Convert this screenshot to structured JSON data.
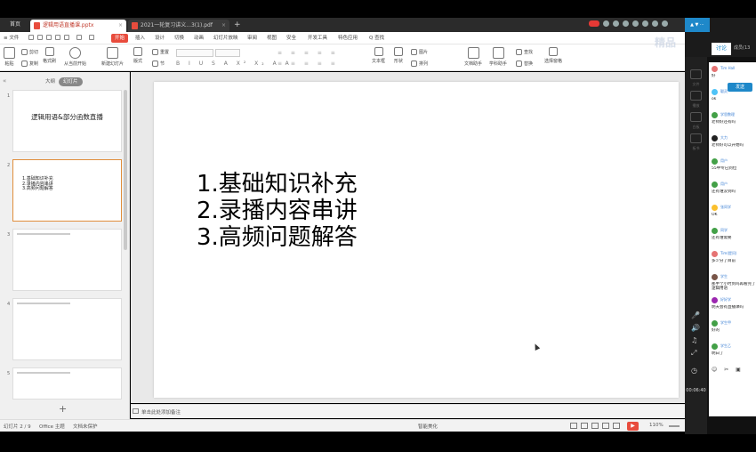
{
  "tabs": {
    "home": "首页",
    "active_doc": "逻辑用语直播课.pptx",
    "other_doc": "2021一轮复习讲义...3(1).pdf",
    "active_color": "#e84c3d",
    "pdf_color": "#e84c3d"
  },
  "menu": {
    "file": "≡ 文件",
    "start": "开始",
    "items": [
      "插入",
      "设计",
      "切换",
      "动画",
      "幻灯片放映",
      "审阅",
      "视图",
      "安全",
      "开发工具",
      "特色应用",
      "Q 查找"
    ]
  },
  "toolbar": {
    "paste": "粘贴",
    "cut": "剪切",
    "copy": "复制",
    "format_painter": "格式刷",
    "from_current": "从当前开始",
    "new_slide": "新建幻灯片",
    "layout": "版式",
    "section": "节",
    "reset": "重置",
    "textbox": "文本框",
    "shape": "形状",
    "arrange": "排列",
    "picture": "图片",
    "doc_assistant": "文档助手",
    "math_assistant": "学科助手",
    "find": "查找",
    "replace": "替换",
    "select_pane": "选择窗格",
    "format_glyphs": "B I U S A X² X₂ A A",
    "align_glyphs": "≡ ≡ ≡ ≡ ≡"
  },
  "panel": {
    "outline_tab": "大纲",
    "slides_tab": "幻灯片",
    "add_glyph": "+",
    "slides": [
      {
        "num": "1",
        "title": "逻辑用语&部分函数直播",
        "lines": []
      },
      {
        "num": "2",
        "title": "",
        "lines": [
          "1.基础知识补充",
          "2.录播内容串讲",
          "3.高频问题解答"
        ]
      },
      {
        "num": "3",
        "title": "",
        "lines": []
      },
      {
        "num": "4",
        "title": "",
        "lines": []
      },
      {
        "num": "5",
        "title": "",
        "lines": []
      }
    ]
  },
  "slide": {
    "lines": [
      "1.基础知识补充",
      "2.录播内容串讲",
      "3.高频问题解答"
    ]
  },
  "notes": {
    "placeholder": "单击此处添加备注"
  },
  "status": {
    "slide_counter": "幻灯片 2 / 9",
    "theme": "Office 主题",
    "doc_protection": "文档未保护",
    "smart_beautify": "智能美化",
    "zoom": "110%"
  },
  "live": {
    "tab_discuss": "讨论",
    "tab_members": "成员(13",
    "watermark": "精品",
    "timer": "00:06:40",
    "side_labels": [
      "文件",
      "播放",
      "白板",
      "板书"
    ],
    "send": "发送",
    "messages": [
      {
        "name": "Tim Hall",
        "text": "好",
        "color": "#e57373"
      },
      {
        "name": "聪灵",
        "text": "ok",
        "color": "#4fc3f7"
      },
      {
        "name": "学思数理",
        "text": "老师好还有吗",
        "color": "#43a047"
      },
      {
        "name": "大力",
        "text": "老师好可以开始吗",
        "color": "#222222"
      },
      {
        "name": "用户",
        "text": "55中专已到位",
        "color": "#43a047"
      },
      {
        "name": "用户",
        "text": "还有谁没到吗",
        "color": "#43a047"
      },
      {
        "name": "张同学",
        "text": "OK",
        "color": "#fbc02d"
      },
      {
        "name": "同学",
        "text": "还有谁需要",
        "color": "#43a047"
      },
      {
        "name": "Tim(提问)",
        "text": "多少分了目前",
        "color": "#e57373"
      },
      {
        "name": "学生",
        "text": "那半个小时到吗再看完了逻辑用语",
        "color": "#795548"
      },
      {
        "name": "好好学",
        "text": "明天会有直播课吗",
        "color": "#9c27b0"
      },
      {
        "name": "学生甲",
        "text": "好的",
        "color": "#43a047"
      },
      {
        "name": "学生乙",
        "text": "明白了",
        "color": "#43a047"
      }
    ]
  }
}
